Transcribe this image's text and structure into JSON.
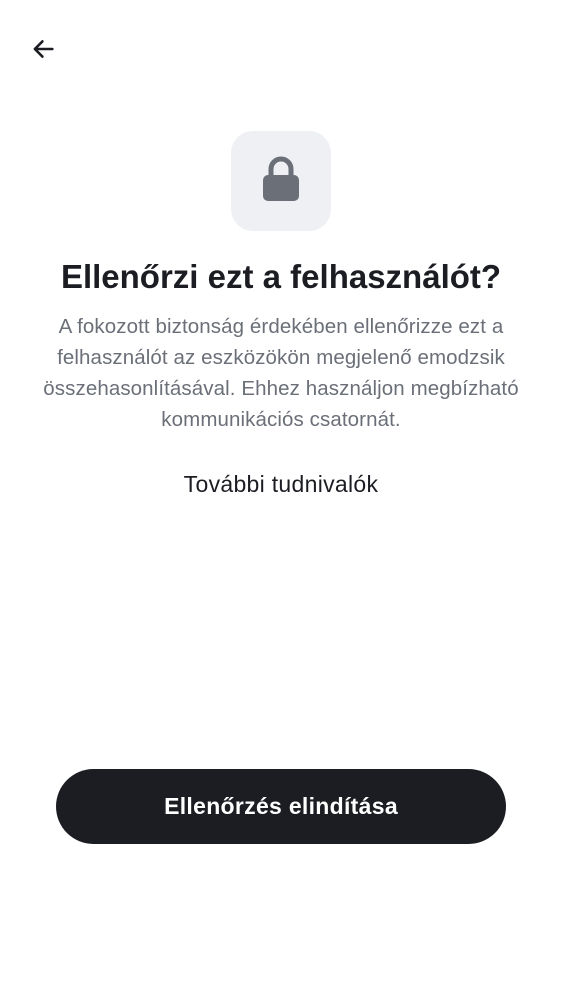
{
  "header": {
    "back_icon": "arrow-left-icon"
  },
  "hero": {
    "icon": "lock-icon",
    "tile_color": "#eef0f4",
    "icon_color": "#6b6f78"
  },
  "content": {
    "title": "Ellenőrzi ezt a felhasználót?",
    "description": "A fokozott biztonság érdekében ellenőrizze ezt a felhasználót az eszközökön megjelenő emodzsik összehasonlításával. Ehhez használjon megbízható kommunikációs csatornát.",
    "learn_more": "További tudnivalók"
  },
  "actions": {
    "start_verification": "Ellenőrzés elindítása",
    "button_color": "#1b1d22"
  }
}
